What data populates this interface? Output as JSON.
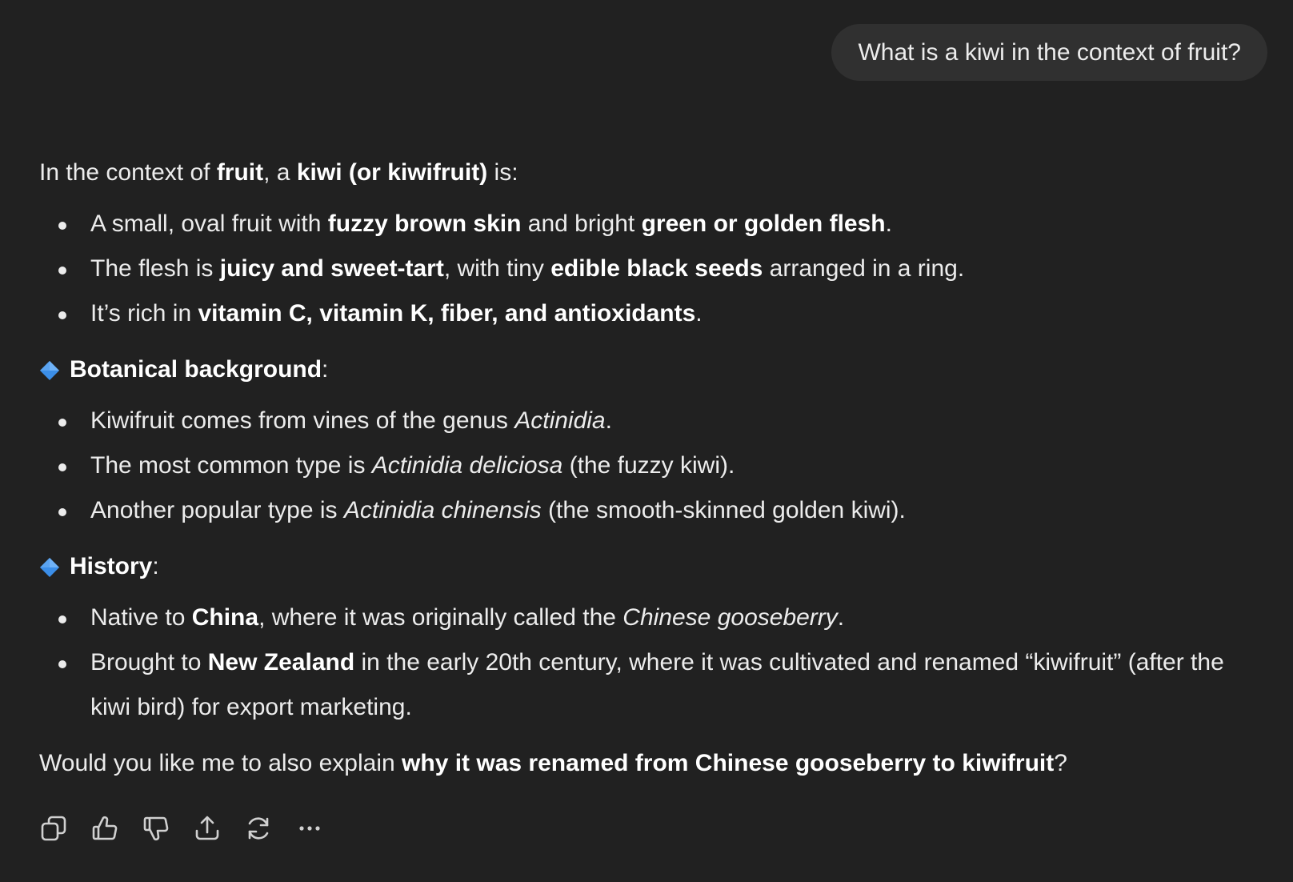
{
  "user_message": "What is a kiwi in the context of fruit?",
  "answer": {
    "intro": {
      "t1": "In the context of ",
      "b1": "fruit",
      "t2": ", a ",
      "b2": "kiwi (or kiwifruit)",
      "t3": " is:"
    },
    "intro_bullets": [
      {
        "t1": "A small, oval fruit with ",
        "b1": "fuzzy brown skin",
        "t2": " and bright ",
        "b2": "green or golden flesh",
        "t3": "."
      },
      {
        "t1": "The flesh is ",
        "b1": "juicy and sweet-tart",
        "t2": ", with tiny ",
        "b2": "edible black seeds",
        "t3": " arranged in a ring."
      },
      {
        "t1": "It’s rich in ",
        "b1": "vitamin C, vitamin K, fiber, and antioxidants",
        "t2": "."
      }
    ],
    "botanical": {
      "heading": "Botanical background",
      "colon": ":",
      "bullets": [
        {
          "t1": "Kiwifruit comes from vines of the genus ",
          "i1": "Actinidia",
          "t2": "."
        },
        {
          "t1": "The most common type is ",
          "i1": "Actinidia deliciosa",
          "t2": " (the fuzzy kiwi)."
        },
        {
          "t1": "Another popular type is ",
          "i1": "Actinidia chinensis",
          "t2": " (the smooth-skinned golden kiwi)."
        }
      ]
    },
    "history": {
      "heading": "History",
      "colon": ":",
      "bullets": [
        {
          "t1": "Native to ",
          "b1": "China",
          "t2": ", where it was originally called the ",
          "i1": "Chinese gooseberry",
          "t3": "."
        },
        {
          "t1": "Brought to ",
          "b1": "New Zealand",
          "t2": " in the early 20th century, where it was cultivated and renamed “kiwifruit” (after the kiwi bird) for export marketing."
        }
      ]
    },
    "closing": {
      "t1": "Would you like me to also explain ",
      "b1": "why it was renamed from Chinese gooseberry to kiwifruit",
      "t2": "?"
    }
  },
  "actions": [
    {
      "icon": "copy-icon"
    },
    {
      "icon": "thumbs-up-icon"
    },
    {
      "icon": "thumbs-down-icon"
    },
    {
      "icon": "share-icon"
    },
    {
      "icon": "regenerate-icon"
    },
    {
      "icon": "more-options-icon"
    }
  ],
  "colors": {
    "background": "#212121",
    "user_bubble": "#303030",
    "text": "#ececec",
    "diamond_emoji": "#3b8ee8"
  }
}
